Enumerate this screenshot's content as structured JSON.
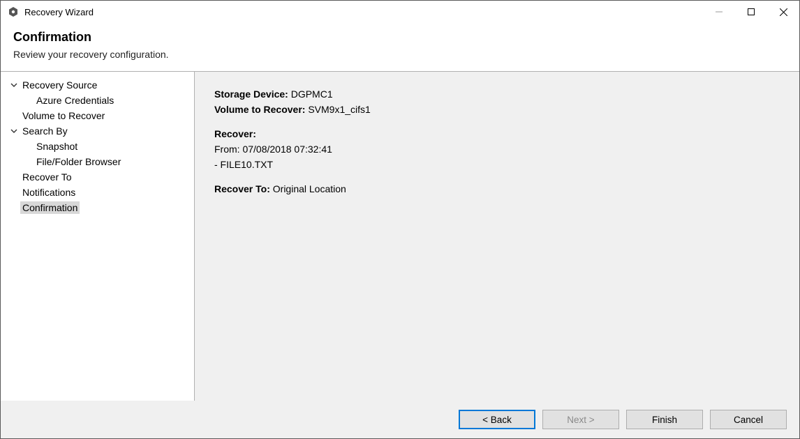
{
  "window": {
    "title": "Recovery Wizard"
  },
  "header": {
    "title": "Confirmation",
    "subtitle": "Review your recovery configuration."
  },
  "sidebar": {
    "items": [
      {
        "label": "Recovery Source",
        "type": "parent"
      },
      {
        "label": "Azure Credentials",
        "type": "child"
      },
      {
        "label": "Volume to Recover",
        "type": "plain"
      },
      {
        "label": "Search By",
        "type": "parent"
      },
      {
        "label": "Snapshot",
        "type": "child"
      },
      {
        "label": "File/Folder Browser",
        "type": "child"
      },
      {
        "label": "Recover To",
        "type": "plain"
      },
      {
        "label": "Notifications",
        "type": "plain"
      },
      {
        "label": "Confirmation",
        "type": "plain",
        "selected": true
      }
    ]
  },
  "content": {
    "storage_device_label": "Storage Device:",
    "storage_device_value": "DGPMC1",
    "volume_label": "Volume to Recover:",
    "volume_value": "SVM9x1_cifs1",
    "recover_label": "Recover:",
    "from_label": "From:",
    "from_value": "07/08/2018 07:32:41",
    "file_item": " - FILE10.TXT",
    "recover_to_label": "Recover To:",
    "recover_to_value": "Original Location"
  },
  "footer": {
    "back": "< Back",
    "next": "Next >",
    "finish": "Finish",
    "cancel": "Cancel"
  }
}
